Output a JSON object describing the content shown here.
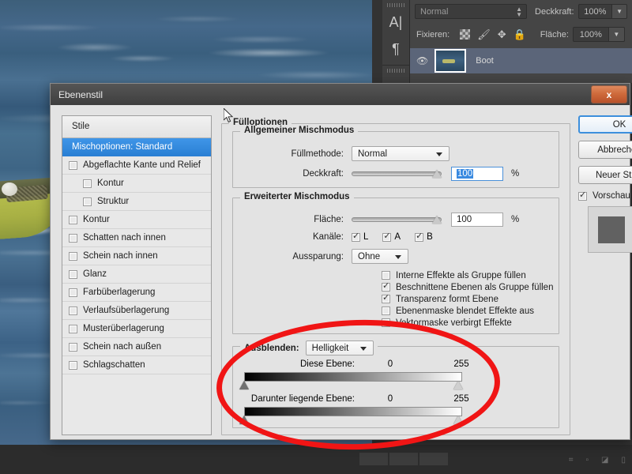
{
  "photoshop": {
    "tool_strip": {
      "grip_icon": "grip-dots",
      "text_tool_icon": "A|",
      "paragraph_tool_icon": "¶",
      "action_tool_icon": "⧉"
    },
    "layers_panel": {
      "blend_mode": "Normal",
      "opacity_label": "Deckkraft:",
      "opacity_value": "100%",
      "lock_label": "Fixieren:",
      "lock_icons": [
        "transparency-checker-icon",
        "brush-icon",
        "move-icon",
        "lock-icon"
      ],
      "fill_label": "Fläche:",
      "fill_value": "100%",
      "layer": {
        "name": "Boot",
        "visibility_icon": "eye-icon"
      }
    }
  },
  "dialog": {
    "title": "Ebenenstil",
    "close_label": "x",
    "styles": {
      "header": "Stile",
      "items": [
        {
          "label": "Mischoptionen: Standard",
          "selected": true,
          "checkbox": false,
          "checked": false,
          "indent": false
        },
        {
          "label": "Abgeflachte Kante und Relief",
          "selected": false,
          "checkbox": true,
          "checked": false,
          "indent": false
        },
        {
          "label": "Kontur",
          "selected": false,
          "checkbox": true,
          "checked": false,
          "indent": true
        },
        {
          "label": "Struktur",
          "selected": false,
          "checkbox": true,
          "checked": false,
          "indent": true
        },
        {
          "label": "Kontur",
          "selected": false,
          "checkbox": true,
          "checked": false,
          "indent": false
        },
        {
          "label": "Schatten nach innen",
          "selected": false,
          "checkbox": true,
          "checked": false,
          "indent": false
        },
        {
          "label": "Schein nach innen",
          "selected": false,
          "checkbox": true,
          "checked": false,
          "indent": false
        },
        {
          "label": "Glanz",
          "selected": false,
          "checkbox": true,
          "checked": false,
          "indent": false
        },
        {
          "label": "Farbüberlagerung",
          "selected": false,
          "checkbox": true,
          "checked": false,
          "indent": false
        },
        {
          "label": "Verlaufsüberlagerung",
          "selected": false,
          "checkbox": true,
          "checked": false,
          "indent": false
        },
        {
          "label": "Musterüberlagerung",
          "selected": false,
          "checkbox": true,
          "checked": false,
          "indent": false
        },
        {
          "label": "Schein nach außen",
          "selected": false,
          "checkbox": true,
          "checked": false,
          "indent": false
        },
        {
          "label": "Schlagschatten",
          "selected": false,
          "checkbox": true,
          "checked": false,
          "indent": false
        }
      ]
    },
    "fill_options": {
      "legend": "Fülloptionen",
      "general": {
        "legend": "Allgemeiner Mischmodus",
        "blend_mode_label": "Füllmethode:",
        "blend_mode_value": "Normal",
        "opacity_label": "Deckkraft:",
        "opacity_value": "100",
        "opacity_unit": "%"
      },
      "advanced": {
        "legend": "Erweiterter Mischmodus",
        "fill_label": "Fläche:",
        "fill_value": "100",
        "fill_unit": "%",
        "channels_label": "Kanäle:",
        "channels": [
          {
            "label": "L",
            "checked": true
          },
          {
            "label": "A",
            "checked": true
          },
          {
            "label": "B",
            "checked": true
          }
        ],
        "knockout_label": "Aussparung:",
        "knockout_value": "Ohne",
        "checkboxes": [
          {
            "label": "Interne Effekte als Gruppe füllen",
            "checked": false
          },
          {
            "label": "Beschnittene Ebenen als Gruppe füllen",
            "checked": true
          },
          {
            "label": "Transparenz formt Ebene",
            "checked": true
          },
          {
            "label": "Ebenenmaske blendet Effekte aus",
            "checked": false
          },
          {
            "label": "Vektormaske verbirgt Effekte",
            "checked": false
          }
        ]
      },
      "blend_if": {
        "legend_label": "Ausblenden:",
        "legend_value": "Helligkeit",
        "this_layer_label": "Diese Ebene:",
        "this_layer_min": "0",
        "this_layer_max": "255",
        "underlying_label": "Darunter liegende Ebene:",
        "underlying_min": "0",
        "underlying_max": "255"
      }
    },
    "buttons": {
      "ok": "OK",
      "cancel": "Abbrechen",
      "new_style": "Neuer Stil...",
      "preview_label": "Vorschau",
      "preview_checked": true
    }
  },
  "annotation": {
    "shape": "red-ellipse-highlight",
    "color": "#f01515"
  }
}
